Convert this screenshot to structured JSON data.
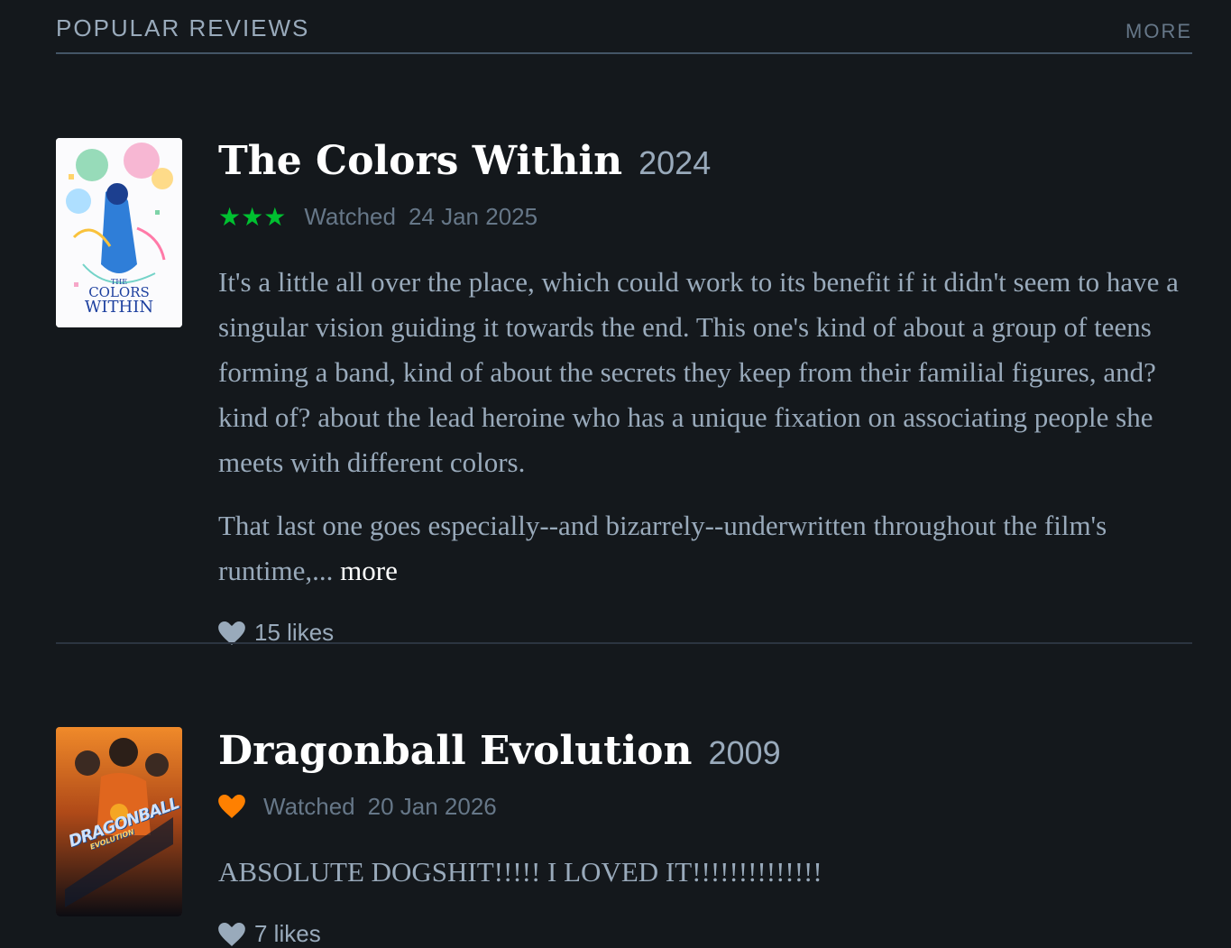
{
  "section": {
    "title": "POPULAR REVIEWS",
    "more_label": "MORE"
  },
  "reviews": [
    {
      "title": "The Colors Within",
      "year": "2024",
      "rating_stars": "★★★",
      "star_color": "#00c030",
      "watched_label": "Watched",
      "watched_date": "24 Jan 2025",
      "paragraphs": [
        "It's a little all over the place, which could work to its benefit if it didn't seem to have a singular vision guiding it towards the end. This one's kind of about a group of teens forming a band, kind of about the secrets they keep from their familial figures, and? kind of? about the lead heroine who has a unique fixation on associating people she meets with different colors.",
        "That last one goes especially--and bizarrely--underwritten throughout the film's runtime,..."
      ],
      "more_label": "more",
      "likes": "15 likes",
      "poster_text": [
        "THE",
        "COLORS",
        "WITHIN"
      ]
    },
    {
      "title": "Dragonball Evolution",
      "year": "2009",
      "liked_icon": "heart-icon",
      "liked_color": "#ff8000",
      "watched_label": "Watched",
      "watched_date": "20 Jan 2026",
      "paragraphs": [
        "ABSOLUTE DOGSHIT!!!!! I LOVED IT!!!!!!!!!!!!!!"
      ],
      "likes": "7 likes",
      "poster_text": [
        "DRAGONBALL",
        "EVOLUTION"
      ]
    }
  ],
  "colors": {
    "background": "#14181c",
    "title": "#ffffff",
    "muted": "#99aabb",
    "like_heart": "#99aabb"
  }
}
